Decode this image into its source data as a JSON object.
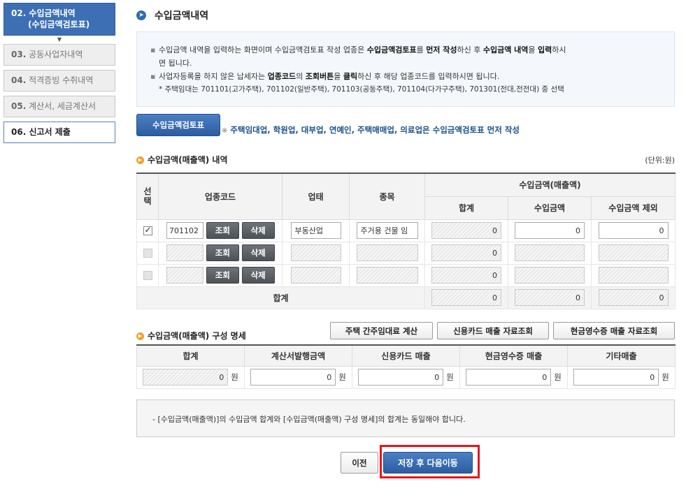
{
  "sidebar": {
    "active_line1": "02. 수입금액내역",
    "active_line2": "(수입금액검토표)",
    "items": [
      {
        "num": "03.",
        "label": "공동사업자내역"
      },
      {
        "num": "04.",
        "label": "적격증빙 수취내역"
      },
      {
        "num": "05.",
        "label": "계산서, 세금계산서"
      },
      {
        "num": "06.",
        "label": "신고서 제출"
      }
    ]
  },
  "page_title": "수입금액내역",
  "notice": {
    "l1_a": "수입금액 내역을 입력하는 화면이며 수입금액검토표 작성 업종은 ",
    "l1_b": "수입금액검토표",
    "l1_c": "를 ",
    "l1_d": "먼저 작성",
    "l1_e": "하신 후 ",
    "l1_f": "수입금액 내역",
    "l1_g": "을 ",
    "l1_h": "입력",
    "l1_i": "하시",
    "l1_j": "면 됩니다.",
    "l2_a": "사업자등록을 하지 않은 납세자는 ",
    "l2_b": "업종코드",
    "l2_c": "의 ",
    "l2_d": "조회버튼",
    "l2_e": "을 ",
    "l2_f": "클릭",
    "l2_g": "하신 후 해당 업종코드를 입력하시면 됩니다.",
    "l3": "* 주택임대는 701101(고가주택), 701102(일반주택), 701103(공동주택), 701104(다가구주택), 701301(전대,전전대) 중 선택"
  },
  "review_button": "수입금액검토표",
  "review_note_mark": "※",
  "review_note": "주택임대업, 학원업, 대부업, 연예인, 주택매매업, 의료업은 수입금액검토표 먼저 작성",
  "section1": {
    "title": "수입금액(매출액) 내역",
    "unit": "(단위:원)",
    "headers": {
      "select": "선택",
      "code": "업종코드",
      "type": "업태",
      "item": "종목",
      "revenue": "수입금액(매출액)",
      "total": "합계",
      "income": "수입금액",
      "excluded": "수입금액 제외"
    },
    "lookup_label": "조회",
    "delete_label": "삭제",
    "rows": [
      {
        "code": "701102",
        "type": "부동산업",
        "item": "주거용 건물 임",
        "total": "0",
        "income": "0",
        "excluded": "0"
      },
      {
        "code": "",
        "type": "",
        "item": "",
        "total": "0",
        "income": "",
        "excluded": ""
      },
      {
        "code": "",
        "type": "",
        "item": "",
        "total": "0",
        "income": "",
        "excluded": ""
      }
    ],
    "sum_label": "합계",
    "sum": {
      "total": "0",
      "income": "0",
      "excluded": "0"
    }
  },
  "section2": {
    "title": "수입금액(매출액) 구성 명세",
    "buttons": [
      "주택 간주임대료 계산",
      "신용카드 매출 자료조회",
      "현금영수증 매출 자료조회"
    ],
    "headers": [
      "합계",
      "계산서발행금액",
      "신용카드 매출",
      "현금영수증 매출",
      "기타매출"
    ],
    "values": [
      "0",
      "0",
      "0",
      "0",
      "0"
    ],
    "won": "원"
  },
  "footer_note": "- [수입금액(매출액)]의 수입금액 합계와 [수입금액(매출액) 구성 명세]의 합계는 동일해야 합니다.",
  "prev_button": "이전",
  "next_button": "저장 후 다음이동"
}
